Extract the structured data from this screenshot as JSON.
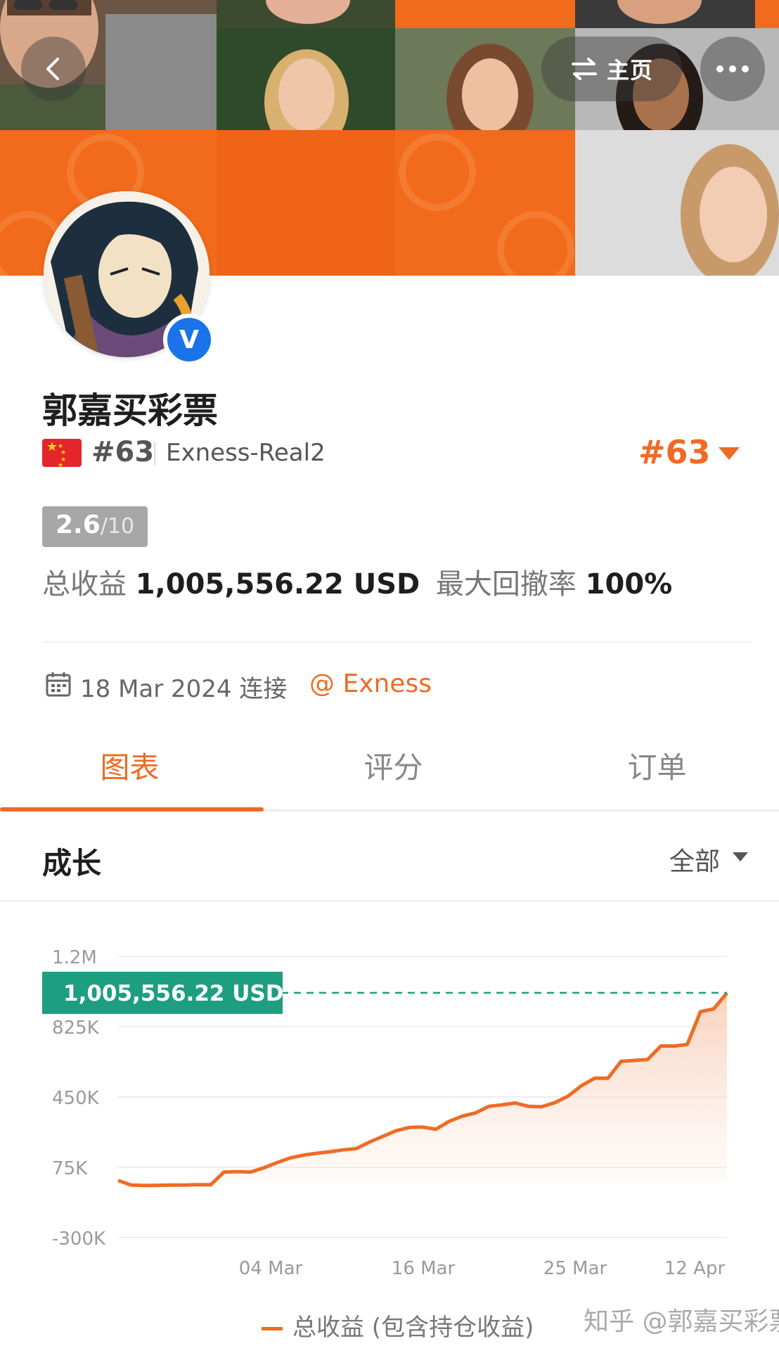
{
  "header": {
    "home_label": "主页"
  },
  "profile": {
    "name": "郭嘉买彩票",
    "verified_mark": "V",
    "rank_left": "#63",
    "account": "Exness-Real2",
    "rank_right": "#63",
    "score": "2.6",
    "score_max": "/10",
    "total_label": "总收益",
    "total_value": "1,005,556.22 USD",
    "drawdown_label": "最大回撤率",
    "drawdown_value": "100%",
    "connected_text": "18 Mar 2024 连接",
    "broker": "@ Exness"
  },
  "tabs": [
    {
      "label": "图表",
      "active": true
    },
    {
      "label": "评分",
      "active": false
    },
    {
      "label": "订单",
      "active": false
    }
  ],
  "growth": {
    "title": "成长",
    "filter": "全部"
  },
  "chart_data": {
    "type": "area",
    "y_ticks": [
      "1.2M",
      "825K",
      "450K",
      "75K",
      "-300K"
    ],
    "y_tick_values": [
      1200000,
      825000,
      450000,
      75000,
      -300000
    ],
    "ylim": [
      -300000,
      1200000
    ],
    "x_ticks": [
      "04 Mar",
      "16 Mar",
      "25 Mar",
      "12 Apr"
    ],
    "current_label": "1,005,556.22 USD",
    "current_value": 1005556.22,
    "series": [
      {
        "name": "总收益 (包含持仓收益)",
        "color": "#ef6b24",
        "values": [
          5000,
          -20000,
          -22000,
          -21000,
          -20000,
          -20000,
          -18000,
          -18000,
          50000,
          52000,
          50000,
          72000,
          100000,
          125000,
          140000,
          150000,
          158000,
          168000,
          175000,
          210000,
          240000,
          270000,
          288000,
          290000,
          278000,
          320000,
          348000,
          365000,
          400000,
          408000,
          418000,
          400000,
          398000,
          420000,
          455000,
          510000,
          550000,
          550000,
          640000,
          645000,
          650000,
          722000,
          722000,
          730000,
          905000,
          920000,
          1005556
        ]
      }
    ]
  },
  "legend": {
    "label": "总收益 (包含持仓收益)"
  },
  "watermark": "知乎 @郭嘉买彩票",
  "colors": {
    "accent": "#ef6b24",
    "highlight": "#1d9e80",
    "verified": "#1a73e8"
  }
}
